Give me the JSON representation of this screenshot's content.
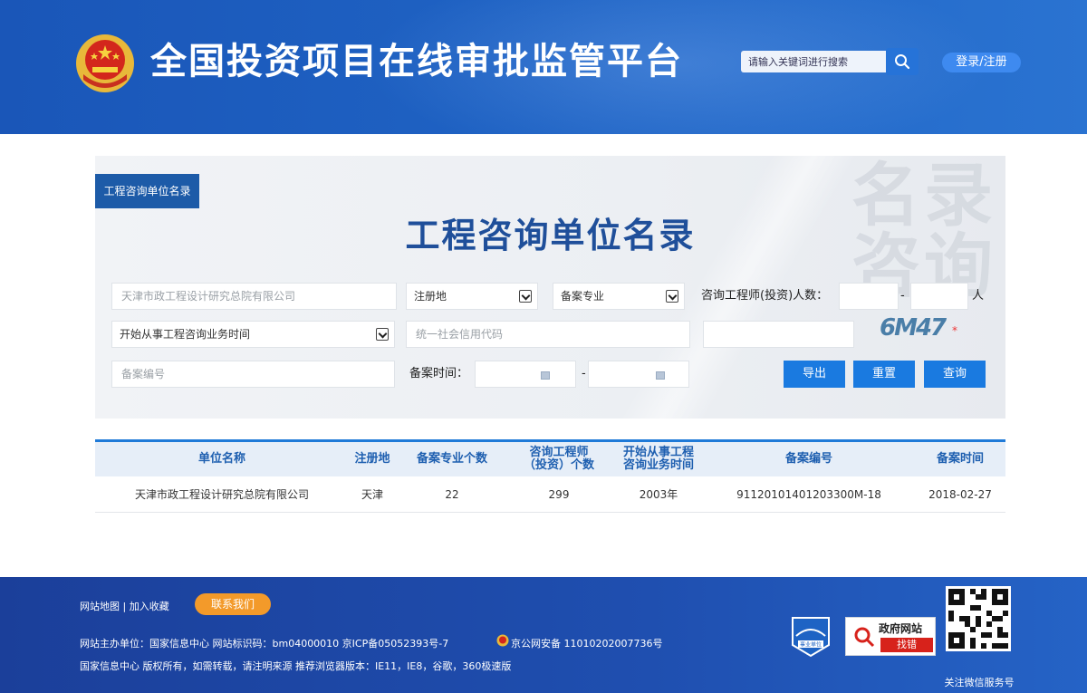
{
  "header": {
    "title": "全国投资项目在线审批监管平台",
    "search_placeholder": "请输入关键词进行搜索",
    "login_label": "登录/注册",
    "icons": {
      "emblem": "national-emblem-icon",
      "search": "search-icon"
    }
  },
  "panel": {
    "tag": "工程咨询单位名录",
    "title": "工程咨询单位名录",
    "watermark": "名录咨询",
    "company_value": "天津市政工程设计研究总院有限公司",
    "region_select": "注册地",
    "specialty_select": "备案专业",
    "engineers_label": "咨询工程师(投资)人数：",
    "range_separator": "-",
    "unit_person": "人",
    "start_time_select": "开始从事工程咨询业务时间",
    "credit_code_placeholder": "统一社会信用代码",
    "captcha_text": "6M47",
    "required_star": "*",
    "record_no_placeholder": "备案编号",
    "record_time_label": "备案时间：",
    "export_label": "导出",
    "reset_label": "重置",
    "query_label": "查询"
  },
  "table": {
    "headers": [
      "单位名称",
      "注册地",
      "备案专业个数",
      "咨询工程师\n（投资）个数",
      "开始从事工程\n咨询业务时间",
      "备案编号",
      "备案时间"
    ],
    "rows": [
      [
        "天津市政工程设计研究总院有限公司",
        "天津",
        "22",
        "299",
        "2003年",
        "91120101401203300M-18",
        "2018-02-27"
      ]
    ]
  },
  "footer": {
    "links": "网站地图 | 加入收藏",
    "contact_label": "联系我们",
    "line1": "网站主办单位：国家信息中心   网站标识码：bm04000010   京ICP备05052393号-7",
    "police_record": "京公网安备 11010202007736号",
    "line2": "国家信息中心 版权所有，如需转载，请注明来源   推荐浏览器版本：IE11，IE8，谷歌，360极速版",
    "badge1_label": "事业单位",
    "badge2_title": "政府网站",
    "badge2_sub": "找错",
    "qr_caption": "关注微信服务号"
  },
  "colors": {
    "header_blue": "#1f63c4",
    "accent_blue": "#1a7ae0",
    "title_blue": "#1f4f9a",
    "orange": "#f39a2a",
    "red": "#d7221b"
  }
}
